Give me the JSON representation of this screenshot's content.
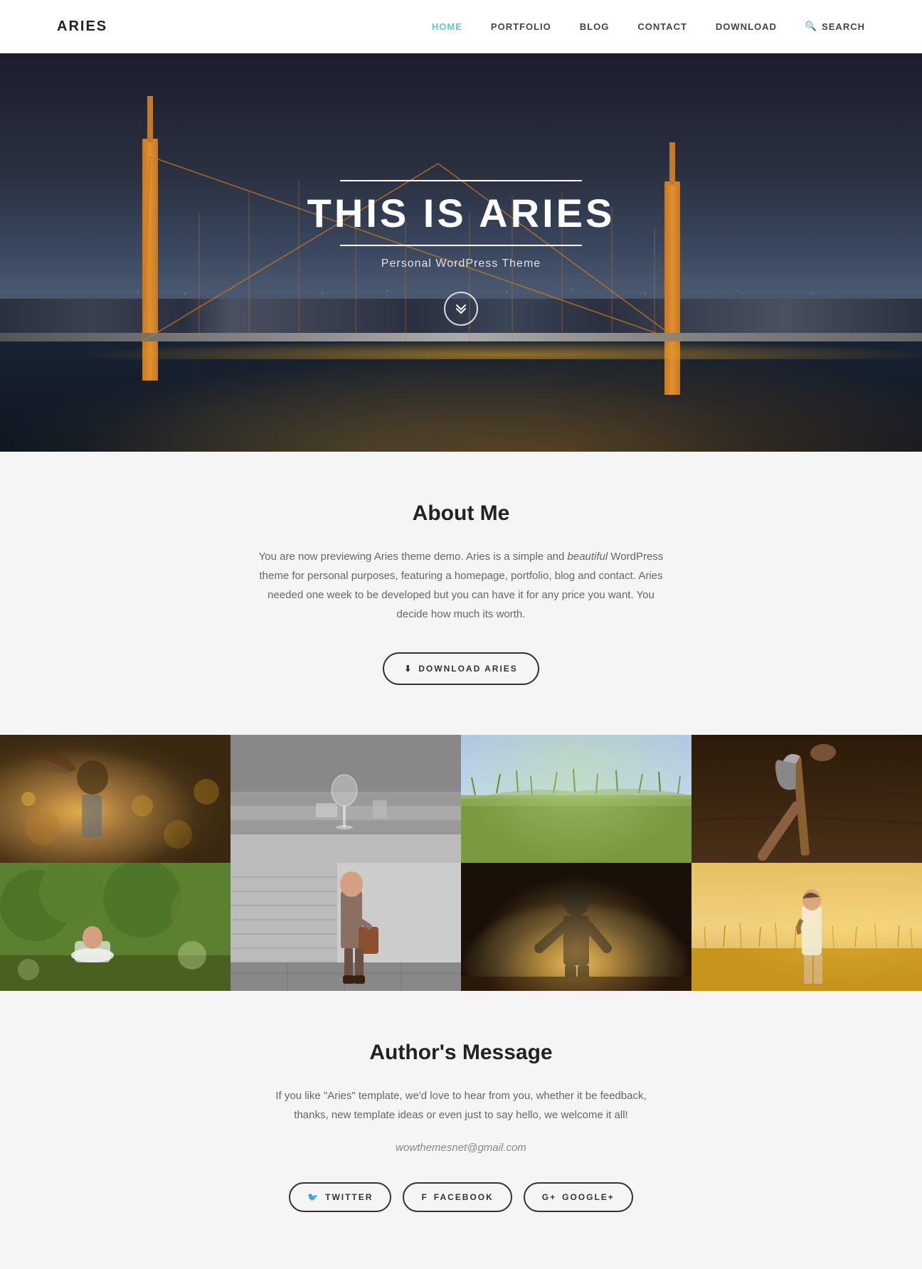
{
  "header": {
    "logo": "ARIES",
    "nav": {
      "home": "HOME",
      "portfolio": "PORTFOLIO",
      "blog": "BLOG",
      "contact": "CONTACT",
      "download": "DOWNLOAD",
      "search": "SEARCH"
    }
  },
  "hero": {
    "title": "THIS IS ARIES",
    "subtitle": "Personal WordPress Theme",
    "scroll_icon": "❯❯"
  },
  "about": {
    "title": "About Me",
    "text_part1": "You are now previewing Aries theme demo. Aries is a simple and ",
    "text_italic": "beautiful",
    "text_part2": " WordPress theme for personal purposes, featuring a homepage, portfolio, blog and contact. Aries needed one week to be developed but you can have it for any price you want. You decide how much its worth.",
    "download_btn": "DOWNLOAD ARIES"
  },
  "gallery": {
    "images": [
      {
        "id": 1,
        "alt": "Woman with windswept hair in autumn"
      },
      {
        "id": 2,
        "alt": "Wine glass on concrete steps"
      },
      {
        "id": 3,
        "alt": "Grass field landscape"
      },
      {
        "id": 4,
        "alt": "Axe in wood"
      },
      {
        "id": 5,
        "alt": "Woman in nature"
      },
      {
        "id": 6,
        "alt": "Person with brown bag"
      },
      {
        "id": 7,
        "alt": "Silhouette in bright light"
      },
      {
        "id": 8,
        "alt": "Woman in wheat field"
      }
    ]
  },
  "author": {
    "title": "Author's Message",
    "text": "If you like \"Aries\" template, we'd love to hear from you, whether it be feedback, thanks, new template ideas or even just to say hello, we welcome it all!",
    "email": "wowthemesnet@gmail.com",
    "social": {
      "twitter": "TWITTER",
      "facebook": "FACEBOOK",
      "googleplus": "GOOGLE+"
    }
  },
  "icons": {
    "download": "⬇",
    "twitter": "🐦",
    "facebook": "f",
    "googleplus": "&",
    "search": "🔍",
    "chevron_down": "⌄"
  }
}
